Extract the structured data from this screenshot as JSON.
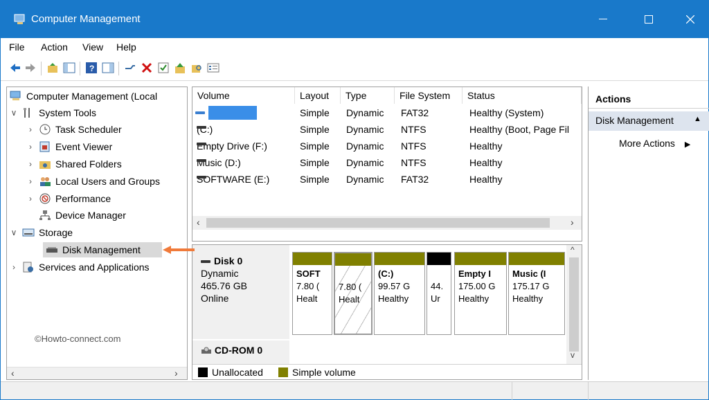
{
  "window": {
    "title": "Computer Management"
  },
  "menu": [
    "File",
    "Action",
    "View",
    "Help"
  ],
  "tree": {
    "root": "Computer Management (Local",
    "items": [
      {
        "label": "System Tools",
        "expanded": true,
        "level": 0,
        "icon": "tools-icon"
      },
      {
        "label": "Task Scheduler",
        "level": 1,
        "icon": "clock-icon"
      },
      {
        "label": "Event Viewer",
        "level": 1,
        "icon": "event-viewer-icon"
      },
      {
        "label": "Shared Folders",
        "level": 1,
        "icon": "shared-folder-icon"
      },
      {
        "label": "Local Users and Groups",
        "level": 1,
        "icon": "users-icon"
      },
      {
        "label": "Performance",
        "level": 1,
        "icon": "performance-icon"
      },
      {
        "label": "Device Manager",
        "level": 1,
        "icon": "device-manager-icon"
      },
      {
        "label": "Storage",
        "expanded": true,
        "level": 0,
        "icon": "storage-icon"
      },
      {
        "label": "Disk Management",
        "level": 1,
        "icon": "disk-icon",
        "selected": true
      },
      {
        "label": "Services and Applications",
        "level": 0,
        "icon": "services-icon"
      }
    ],
    "watermark": "©Howto-connect.com"
  },
  "volume_list": {
    "columns": [
      "Volume",
      "Layout",
      "Type",
      "File System",
      "Status"
    ],
    "rows": [
      {
        "volume": "",
        "layout": "Simple",
        "type": "Dynamic",
        "fs": "FAT32",
        "status": "Healthy (System)"
      },
      {
        "volume": "(C:)",
        "layout": "Simple",
        "type": "Dynamic",
        "fs": "NTFS",
        "status": "Healthy (Boot, Page Fil"
      },
      {
        "volume": "Empty Drive (F:)",
        "layout": "Simple",
        "type": "Dynamic",
        "fs": "NTFS",
        "status": "Healthy"
      },
      {
        "volume": "Music (D:)",
        "layout": "Simple",
        "type": "Dynamic",
        "fs": "NTFS",
        "status": "Healthy"
      },
      {
        "volume": "SOFTWARE (E:)",
        "layout": "Simple",
        "type": "Dynamic",
        "fs": "FAT32",
        "status": "Healthy"
      }
    ]
  },
  "disk0": {
    "name": "Disk 0",
    "type": "Dynamic",
    "size": "465.76 GB",
    "state": "Online",
    "partitions": [
      {
        "l1": "SOFT",
        "l2": "7.80 (",
        "l3": "Healt",
        "bar": "olive"
      },
      {
        "l1": "",
        "l2": "7.80 (",
        "l3": "Healt",
        "bar": "olive"
      },
      {
        "l1": "(C:)",
        "l2": "99.57 G",
        "l3": "Healthy",
        "bar": "olive"
      },
      {
        "l1": "",
        "l2": "44.",
        "l3": "Ur",
        "bar": "black"
      },
      {
        "l1": "Empty I",
        "l2": "175.00 G",
        "l3": "Healthy",
        "bar": "olive"
      },
      {
        "l1": "Music (I",
        "l2": "175.17 G",
        "l3": "Healthy",
        "bar": "olive"
      }
    ]
  },
  "cdrom": {
    "name": "CD-ROM 0"
  },
  "legend": [
    {
      "label": "Unallocated",
      "color": "#000000"
    },
    {
      "label": "Simple volume",
      "color": "#808000"
    }
  ],
  "actions": {
    "header": "Actions",
    "section": "Disk Management",
    "more": "More Actions"
  },
  "colors": {
    "titlebar": "#1979ca",
    "simple_volume": "#808000",
    "selection_arrow": "#f07a3a"
  }
}
